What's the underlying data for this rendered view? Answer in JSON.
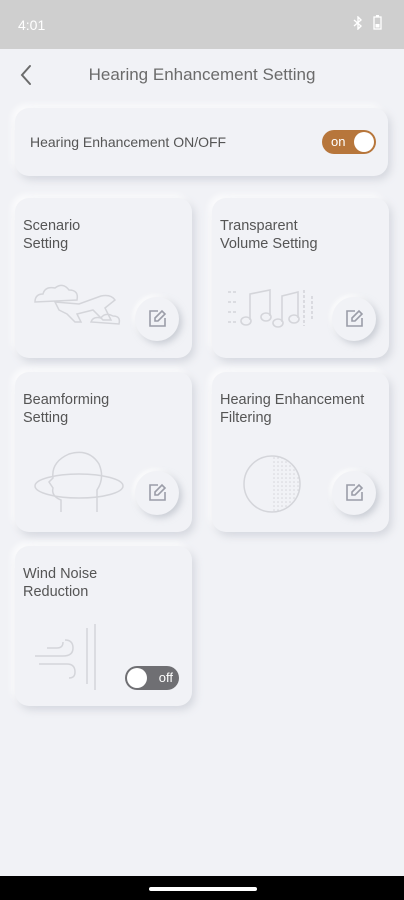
{
  "status_bar": {
    "time": "4:01",
    "icons": [
      "bluetooth-icon",
      "battery-icon"
    ]
  },
  "app_bar": {
    "title": "Hearing Enhancement Setting",
    "back_icon": "chevron-left-icon"
  },
  "master_switch": {
    "label": "Hearing Enhancement ON/OFF",
    "state": "on",
    "state_label": "on",
    "color": "#b7763b"
  },
  "cards": [
    {
      "title": "Scenario\nSetting",
      "illustration": "cloud-airplane-icon",
      "action": "edit-icon"
    },
    {
      "title": "Transparent\nVolume Setting",
      "illustration": "music-notes-icon",
      "action": "edit-icon"
    },
    {
      "title": "Beamforming\nSetting",
      "illustration": "head-beam-icon",
      "action": "edit-icon"
    },
    {
      "title": "Hearing Enhancement\nFiltering",
      "illustration": "filter-circle-icon",
      "action": "edit-icon"
    },
    {
      "title": "Wind Noise\nReduction",
      "illustration": "wind-wall-icon",
      "action": "toggle",
      "state": "off",
      "state_label": "off",
      "color": "#6f6f73"
    }
  ]
}
